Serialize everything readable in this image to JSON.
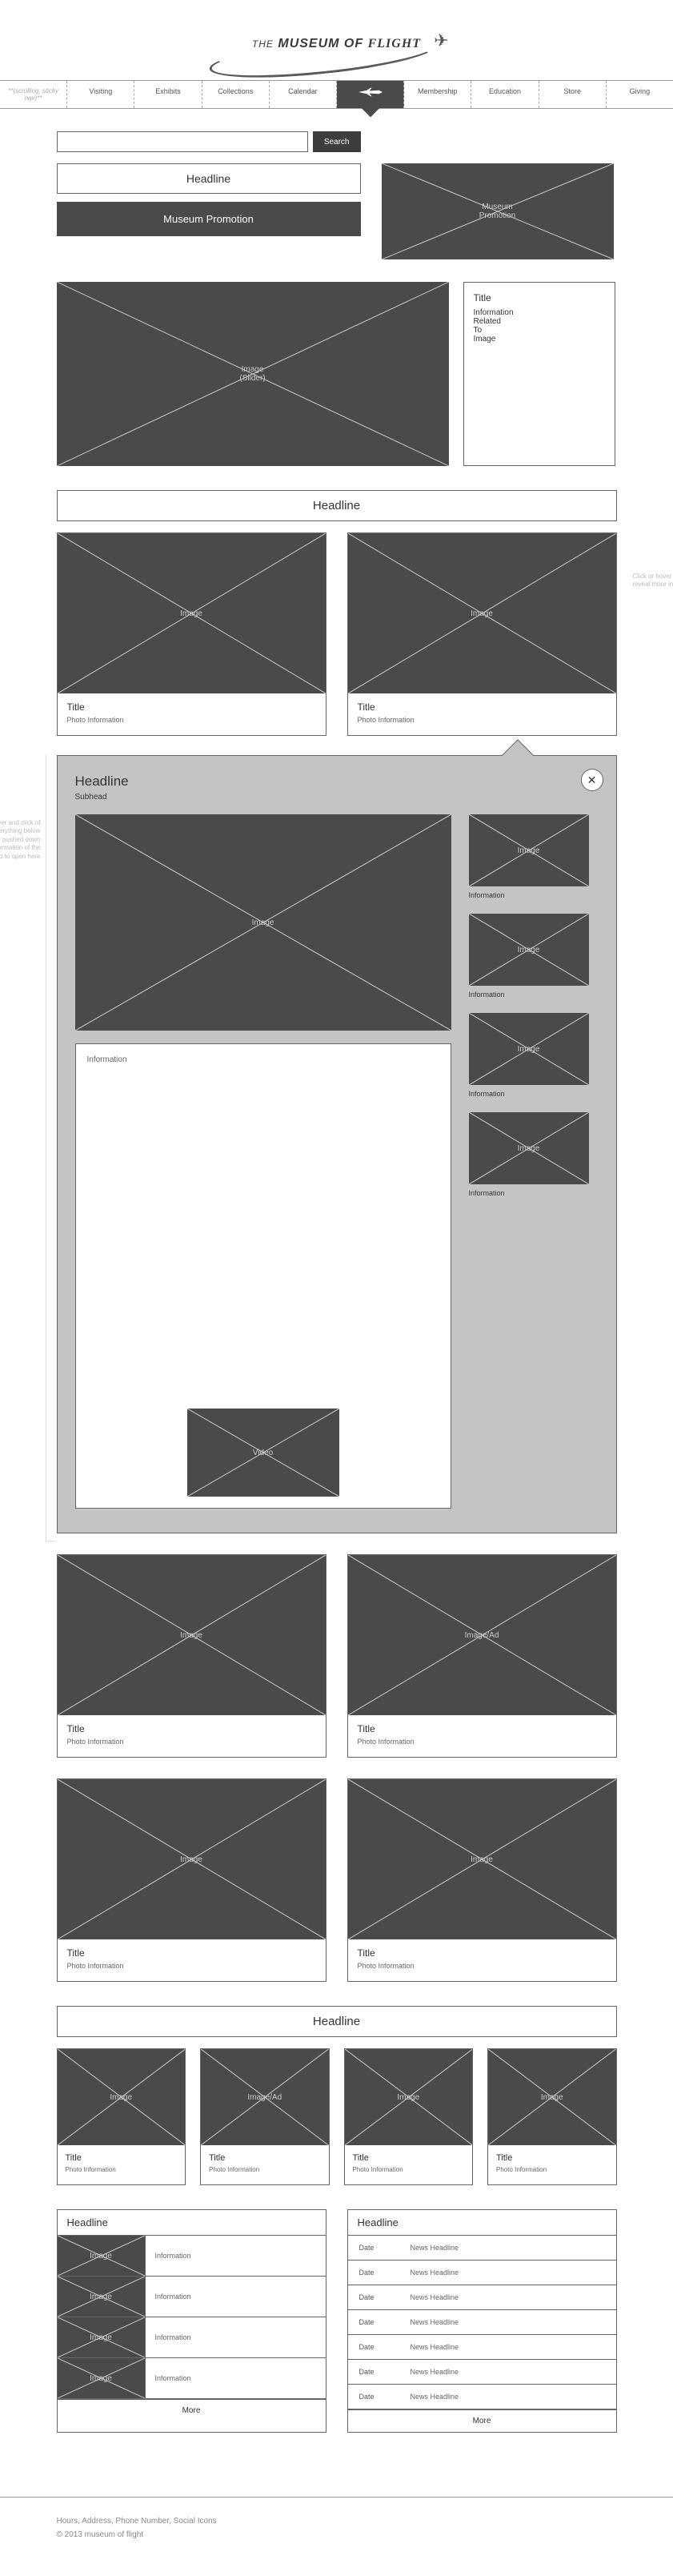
{
  "logo": {
    "the": "THE",
    "museum_of": "MUSEUM OF",
    "flight": "FLIGHT"
  },
  "nav": {
    "tagline": "**(scrolling, sticky nav)**",
    "items": [
      "Visiting",
      "Exhibits",
      "Collections",
      "Calendar",
      "",
      "Membership",
      "Education",
      "Store",
      "Giving"
    ]
  },
  "search": {
    "placeholder": "",
    "button": "Search"
  },
  "top": {
    "headline": "Headline",
    "promotion": "Museum Promotion",
    "promo_img_label": "Museum\nPromotion"
  },
  "slider": {
    "img_label": "Image\n(Slider)",
    "panel": {
      "title": "Title",
      "text": "Information\nRelated\nTo\nImage"
    }
  },
  "section1": {
    "headline": "Headline",
    "note_right": "Click or hover on image to reveal more information",
    "cards": [
      {
        "img": "Image",
        "title": "Title",
        "desc": "Photo Information"
      },
      {
        "img": "Image",
        "title": "Title",
        "desc": "Photo Information"
      }
    ]
  },
  "detail": {
    "headline": "Headline",
    "subhead": "Subhead",
    "note_left": "On roll-over and click of image everything below image gets pushed down and more information of the image referred to open here",
    "main_img": "Image",
    "info_label": "Information",
    "video_label": "Video",
    "thumbs": [
      {
        "img": "Image",
        "label": "Information"
      },
      {
        "img": "Image",
        "label": "Information"
      },
      {
        "img": "Image",
        "label": "Information"
      },
      {
        "img": "Image",
        "label": "Information"
      }
    ]
  },
  "section2": {
    "rows": [
      [
        {
          "img": "Image",
          "title": "Title",
          "desc": "Photo Information"
        },
        {
          "img": "Image/Ad",
          "title": "Title",
          "desc": "Photo Information"
        }
      ],
      [
        {
          "img": "Image",
          "title": "Title",
          "desc": "Photo Information"
        },
        {
          "img": "Image",
          "title": "Title",
          "desc": "Photo Information"
        }
      ]
    ]
  },
  "section3": {
    "headline": "Headline",
    "cards": [
      {
        "img": "Image",
        "title": "Title",
        "desc": "Photo Information"
      },
      {
        "img": "Image/Ad",
        "title": "Title",
        "desc": "Photo Information"
      },
      {
        "img": "Image",
        "title": "Title",
        "desc": "Photo Information"
      },
      {
        "img": "Image",
        "title": "Title",
        "desc": "Photo Information"
      }
    ]
  },
  "bottom": {
    "left": {
      "headline": "Headline",
      "rows": [
        {
          "img": "Image",
          "text": "Information"
        },
        {
          "img": "Image",
          "text": "Information"
        },
        {
          "img": "Image",
          "text": "Information"
        },
        {
          "img": "Image",
          "text": "Information"
        }
      ],
      "more": "More"
    },
    "right": {
      "headline": "Headline",
      "rows": [
        {
          "date": "Date",
          "headline": "News Headline"
        },
        {
          "date": "Date",
          "headline": "News Headline"
        },
        {
          "date": "Date",
          "headline": "News Headline"
        },
        {
          "date": "Date",
          "headline": "News Headline"
        },
        {
          "date": "Date",
          "headline": "News Headline"
        },
        {
          "date": "Date",
          "headline": "News Headline"
        },
        {
          "date": "Date",
          "headline": "News Headline"
        }
      ],
      "more": "More"
    }
  },
  "footer": {
    "line1": "Hours, Address, Phone Number, Social Icons",
    "line2": "© 2013 museum of flight"
  }
}
